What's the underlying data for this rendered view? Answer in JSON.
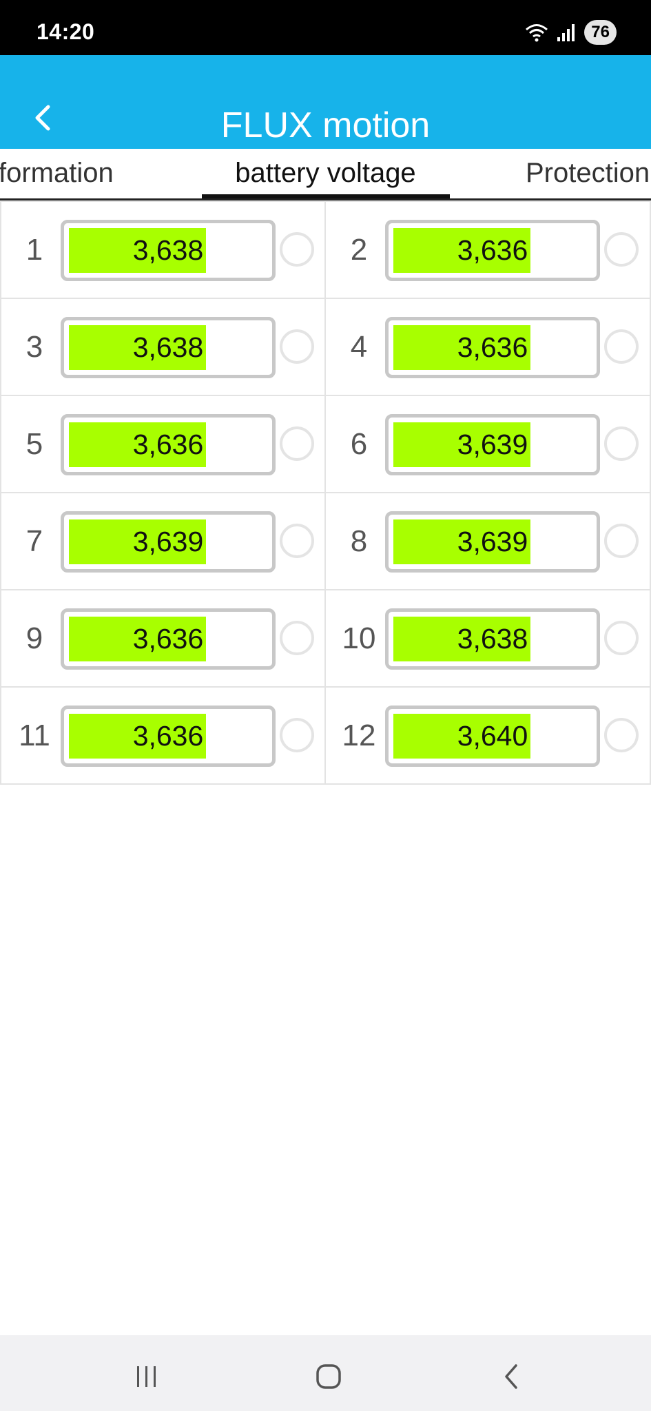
{
  "status_bar": {
    "time": "14:20",
    "battery_level": "76",
    "icons": [
      "wifi-icon",
      "signal-icon"
    ]
  },
  "app_bar": {
    "title": "FLUX motion",
    "back_icon": "back-chevron-icon",
    "background_color": "#17b3ea"
  },
  "tabs": [
    {
      "label": "formation",
      "active": false
    },
    {
      "label": "battery voltage",
      "active": true
    },
    {
      "label": "Protection",
      "active": false
    }
  ],
  "cells": [
    {
      "index": "1",
      "value": "3,638",
      "fill": 0.68
    },
    {
      "index": "2",
      "value": "3,636",
      "fill": 0.68
    },
    {
      "index": "3",
      "value": "3,638",
      "fill": 0.68
    },
    {
      "index": "4",
      "value": "3,636",
      "fill": 0.68
    },
    {
      "index": "5",
      "value": "3,636",
      "fill": 0.68
    },
    {
      "index": "6",
      "value": "3,639",
      "fill": 0.68
    },
    {
      "index": "7",
      "value": "3,639",
      "fill": 0.68
    },
    {
      "index": "8",
      "value": "3,639",
      "fill": 0.68
    },
    {
      "index": "9",
      "value": "3,636",
      "fill": 0.68
    },
    {
      "index": "10",
      "value": "3,638",
      "fill": 0.68
    },
    {
      "index": "11",
      "value": "3,636",
      "fill": 0.68
    },
    {
      "index": "12",
      "value": "3,640",
      "fill": 0.68
    }
  ],
  "colors": {
    "bar_fill": "#a8ff00",
    "bar_border": "#c8c8c8"
  },
  "nav_bar": {
    "icons": [
      "recent-apps-icon",
      "home-icon",
      "back-icon"
    ]
  }
}
